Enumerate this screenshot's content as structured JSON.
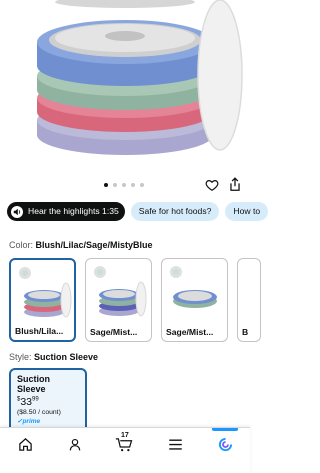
{
  "gallery": {
    "dot_count": 5,
    "active_dot": 0
  },
  "pills": [
    {
      "label": "Hear the highlights 1:35",
      "style": "dark"
    },
    {
      "label": "Safe for hot foods?",
      "style": "light"
    },
    {
      "label": "How to",
      "style": "light"
    }
  ],
  "color": {
    "key": "Color:",
    "value": "Blush/Lilac/Sage/MistyBlue",
    "options": [
      {
        "label": "Blush/Lila...",
        "selected": true
      },
      {
        "label": "Sage/Mist...",
        "selected": false
      },
      {
        "label": "Sage/Mist...",
        "selected": false
      },
      {
        "label": "B",
        "selected": false
      }
    ]
  },
  "style": {
    "key": "Style:",
    "value": "Suction Sleeve",
    "card": {
      "name": "Suction Sleeve",
      "price_symbol": "$",
      "price_whole": "33",
      "price_fraction": "99",
      "unit_price": "($8.50 / count)",
      "prime": "prime"
    }
  },
  "nav": {
    "cart_count": "17",
    "items": [
      "home-icon",
      "account-icon",
      "cart-icon",
      "menu-icon",
      "assistant-icon"
    ]
  },
  "colors": {
    "accent": "#2162a1",
    "pill_light": "#d7ecfa",
    "prime_blue": "#1a98ff"
  }
}
